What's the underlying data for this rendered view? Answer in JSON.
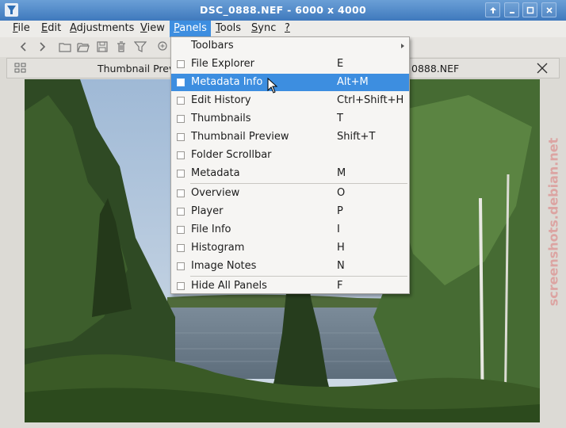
{
  "window": {
    "title": "DSC_0888.NEF  - 6000 x 4000"
  },
  "menubar": {
    "items": [
      {
        "label": "File",
        "u": "F",
        "rest": "ile"
      },
      {
        "label": "Edit",
        "u": "E",
        "rest": "dit"
      },
      {
        "label": "Adjustments",
        "u": "A",
        "rest": "djustments"
      },
      {
        "label": "View",
        "u": "V",
        "rest": "iew"
      },
      {
        "label": "Panels",
        "u": "P",
        "rest": "anels"
      },
      {
        "label": "Tools",
        "u": "T",
        "rest": "ools"
      },
      {
        "label": "Sync",
        "u": "S",
        "rest": "ync"
      },
      {
        "label": "?",
        "u": "?",
        "rest": ""
      }
    ]
  },
  "tabs": {
    "first": "Thumbnail Preview",
    "second": "0888.NEF"
  },
  "panels_menu": {
    "items": [
      {
        "label": "Toolbars",
        "submenu": true
      },
      {
        "label": "File Explorer",
        "shortcut": "E"
      },
      {
        "label": "Metadata Info",
        "shortcut": "Alt+M",
        "highlighted": true
      },
      {
        "label": "Edit History",
        "shortcut": "Ctrl+Shift+H"
      },
      {
        "label": "Thumbnails",
        "shortcut": "T"
      },
      {
        "label": "Thumbnail Preview",
        "shortcut": "Shift+T"
      },
      {
        "label": "Folder Scrollbar",
        "shortcut": ""
      },
      {
        "label": "Metadata",
        "shortcut": "M"
      },
      {
        "label": "Overview",
        "shortcut": "O"
      },
      {
        "label": "Player",
        "shortcut": "P"
      },
      {
        "label": "File Info",
        "shortcut": "I"
      },
      {
        "label": "Histogram",
        "shortcut": "H"
      },
      {
        "label": "Image Notes",
        "shortcut": "N"
      },
      {
        "label": "Hide All Panels",
        "shortcut": "F"
      }
    ]
  },
  "watermark": "screenshots.debian.net",
  "colors": {
    "titlebar": "#4a86c8",
    "highlight": "#3d8ee0",
    "menu_bg": "#f6f5f3"
  }
}
